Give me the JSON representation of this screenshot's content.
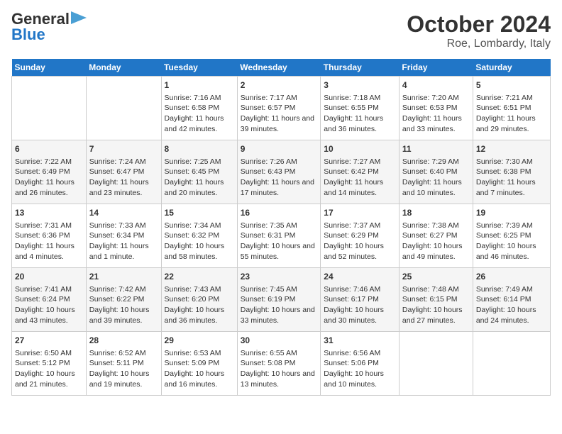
{
  "header": {
    "logo_line1": "General",
    "logo_line2": "Blue",
    "title": "October 2024",
    "subtitle": "Roe, Lombardy, Italy"
  },
  "columns": [
    "Sunday",
    "Monday",
    "Tuesday",
    "Wednesday",
    "Thursday",
    "Friday",
    "Saturday"
  ],
  "weeks": [
    [
      {
        "day": "",
        "info": ""
      },
      {
        "day": "",
        "info": ""
      },
      {
        "day": "1",
        "info": "Sunrise: 7:16 AM\nSunset: 6:58 PM\nDaylight: 11 hours and 42 minutes."
      },
      {
        "day": "2",
        "info": "Sunrise: 7:17 AM\nSunset: 6:57 PM\nDaylight: 11 hours and 39 minutes."
      },
      {
        "day": "3",
        "info": "Sunrise: 7:18 AM\nSunset: 6:55 PM\nDaylight: 11 hours and 36 minutes."
      },
      {
        "day": "4",
        "info": "Sunrise: 7:20 AM\nSunset: 6:53 PM\nDaylight: 11 hours and 33 minutes."
      },
      {
        "day": "5",
        "info": "Sunrise: 7:21 AM\nSunset: 6:51 PM\nDaylight: 11 hours and 29 minutes."
      }
    ],
    [
      {
        "day": "6",
        "info": "Sunrise: 7:22 AM\nSunset: 6:49 PM\nDaylight: 11 hours and 26 minutes."
      },
      {
        "day": "7",
        "info": "Sunrise: 7:24 AM\nSunset: 6:47 PM\nDaylight: 11 hours and 23 minutes."
      },
      {
        "day": "8",
        "info": "Sunrise: 7:25 AM\nSunset: 6:45 PM\nDaylight: 11 hours and 20 minutes."
      },
      {
        "day": "9",
        "info": "Sunrise: 7:26 AM\nSunset: 6:43 PM\nDaylight: 11 hours and 17 minutes."
      },
      {
        "day": "10",
        "info": "Sunrise: 7:27 AM\nSunset: 6:42 PM\nDaylight: 11 hours and 14 minutes."
      },
      {
        "day": "11",
        "info": "Sunrise: 7:29 AM\nSunset: 6:40 PM\nDaylight: 11 hours and 10 minutes."
      },
      {
        "day": "12",
        "info": "Sunrise: 7:30 AM\nSunset: 6:38 PM\nDaylight: 11 hours and 7 minutes."
      }
    ],
    [
      {
        "day": "13",
        "info": "Sunrise: 7:31 AM\nSunset: 6:36 PM\nDaylight: 11 hours and 4 minutes."
      },
      {
        "day": "14",
        "info": "Sunrise: 7:33 AM\nSunset: 6:34 PM\nDaylight: 11 hours and 1 minute."
      },
      {
        "day": "15",
        "info": "Sunrise: 7:34 AM\nSunset: 6:32 PM\nDaylight: 10 hours and 58 minutes."
      },
      {
        "day": "16",
        "info": "Sunrise: 7:35 AM\nSunset: 6:31 PM\nDaylight: 10 hours and 55 minutes."
      },
      {
        "day": "17",
        "info": "Sunrise: 7:37 AM\nSunset: 6:29 PM\nDaylight: 10 hours and 52 minutes."
      },
      {
        "day": "18",
        "info": "Sunrise: 7:38 AM\nSunset: 6:27 PM\nDaylight: 10 hours and 49 minutes."
      },
      {
        "day": "19",
        "info": "Sunrise: 7:39 AM\nSunset: 6:25 PM\nDaylight: 10 hours and 46 minutes."
      }
    ],
    [
      {
        "day": "20",
        "info": "Sunrise: 7:41 AM\nSunset: 6:24 PM\nDaylight: 10 hours and 43 minutes."
      },
      {
        "day": "21",
        "info": "Sunrise: 7:42 AM\nSunset: 6:22 PM\nDaylight: 10 hours and 39 minutes."
      },
      {
        "day": "22",
        "info": "Sunrise: 7:43 AM\nSunset: 6:20 PM\nDaylight: 10 hours and 36 minutes."
      },
      {
        "day": "23",
        "info": "Sunrise: 7:45 AM\nSunset: 6:19 PM\nDaylight: 10 hours and 33 minutes."
      },
      {
        "day": "24",
        "info": "Sunrise: 7:46 AM\nSunset: 6:17 PM\nDaylight: 10 hours and 30 minutes."
      },
      {
        "day": "25",
        "info": "Sunrise: 7:48 AM\nSunset: 6:15 PM\nDaylight: 10 hours and 27 minutes."
      },
      {
        "day": "26",
        "info": "Sunrise: 7:49 AM\nSunset: 6:14 PM\nDaylight: 10 hours and 24 minutes."
      }
    ],
    [
      {
        "day": "27",
        "info": "Sunrise: 6:50 AM\nSunset: 5:12 PM\nDaylight: 10 hours and 21 minutes."
      },
      {
        "day": "28",
        "info": "Sunrise: 6:52 AM\nSunset: 5:11 PM\nDaylight: 10 hours and 19 minutes."
      },
      {
        "day": "29",
        "info": "Sunrise: 6:53 AM\nSunset: 5:09 PM\nDaylight: 10 hours and 16 minutes."
      },
      {
        "day": "30",
        "info": "Sunrise: 6:55 AM\nSunset: 5:08 PM\nDaylight: 10 hours and 13 minutes."
      },
      {
        "day": "31",
        "info": "Sunrise: 6:56 AM\nSunset: 5:06 PM\nDaylight: 10 hours and 10 minutes."
      },
      {
        "day": "",
        "info": ""
      },
      {
        "day": "",
        "info": ""
      }
    ]
  ]
}
